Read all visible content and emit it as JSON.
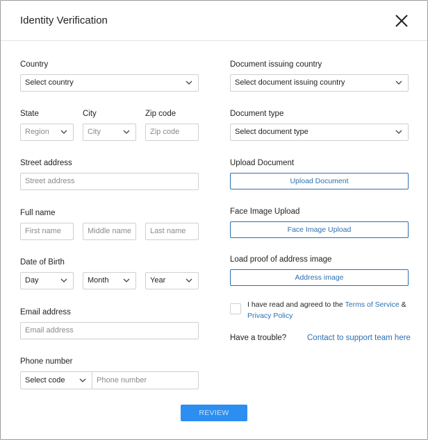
{
  "dialog": {
    "title": "Identity Verification"
  },
  "left": {
    "country_label": "Country",
    "country_value": "Select country",
    "state_label": "State",
    "state_value": "Region",
    "city_label": "City",
    "city_value": "City",
    "zip_label": "Zip code",
    "zip_placeholder": "Zip code",
    "street_label": "Street address",
    "street_placeholder": "Street address",
    "fullname_label": "Full name",
    "first_placeholder": "First name",
    "middle_placeholder": "Middle name",
    "last_placeholder": "Last name",
    "dob_label": "Date of Birth",
    "day_value": "Day",
    "month_value": "Month",
    "year_value": "Year",
    "email_label": "Email address",
    "email_placeholder": "Email address",
    "phone_label": "Phone number",
    "phone_code_value": "Select code",
    "phone_placeholder": "Phone number"
  },
  "right": {
    "doc_country_label": "Document issuing country",
    "doc_country_value": "Select document issuing country",
    "doc_type_label": "Document type",
    "doc_type_value": "Select document type",
    "upload_doc_label": "Upload Document",
    "upload_doc_button": "Upload Document",
    "face_label": "Face Image Upload",
    "face_button": "Face Image Upload",
    "proof_label": "Load proof of address image",
    "proof_button": "Address image",
    "terms_prefix": "I have read and agreed to the ",
    "terms_link": "Terms of Service",
    "terms_amp": " &",
    "privacy_link": "Privacy Policy",
    "trouble_text": "Have a trouble?",
    "support_link": "Contact to support team here"
  },
  "footer": {
    "review_button": "REVIEW"
  },
  "colors": {
    "accent": "#2c6fb0",
    "review_bg": "#2b8ef0",
    "border": "#cfcfcf"
  },
  "icons": {
    "close": "close-icon",
    "dropdown": "chevron-down-icon"
  }
}
